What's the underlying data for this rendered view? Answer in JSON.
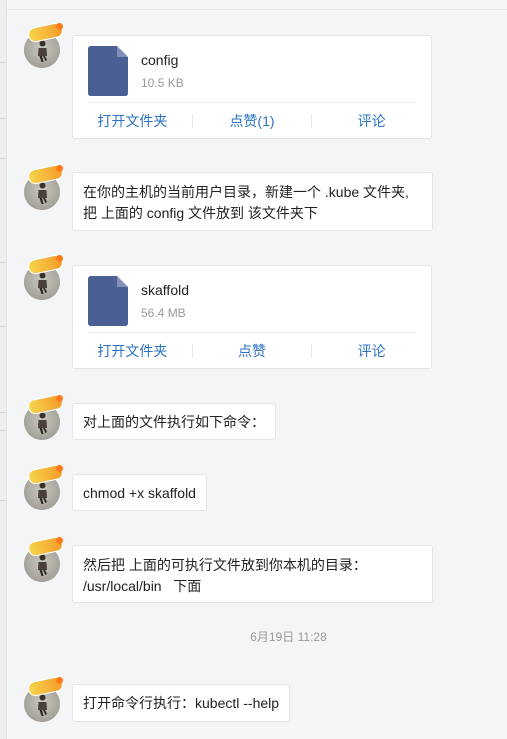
{
  "messages": {
    "file1": {
      "name": "config",
      "size": "10.5 KB",
      "actions": [
        "打开文件夹",
        "点赞(1)",
        "评论"
      ]
    },
    "text1": {
      "line1": "在你的主机的当前用户目录，新建一个 .kube 文件夹,",
      "line2": "把 上面的 config 文件放到 该文件夹下"
    },
    "file2": {
      "name": "skaffold",
      "size": "56.4 MB",
      "actions": [
        "打开文件夹",
        "点赞",
        "评论"
      ]
    },
    "text2": "对上面的文件执行如下命令：",
    "text3": "chmod +x skaffold",
    "text4": {
      "line1": "然后把 上面的可执行文件放到你本机的目录：",
      "line2": "/usr/local/bin   下面"
    },
    "timestamp": "6月19日 11:28",
    "text5": "打开命令行执行：kubectl --help"
  },
  "colors": {
    "link": "#2a73c5",
    "file_icon": "#4a5f94",
    "bubble_border": "#e3e5e8"
  },
  "icons": {
    "avatar": "user-avatar",
    "file": "document-icon"
  }
}
